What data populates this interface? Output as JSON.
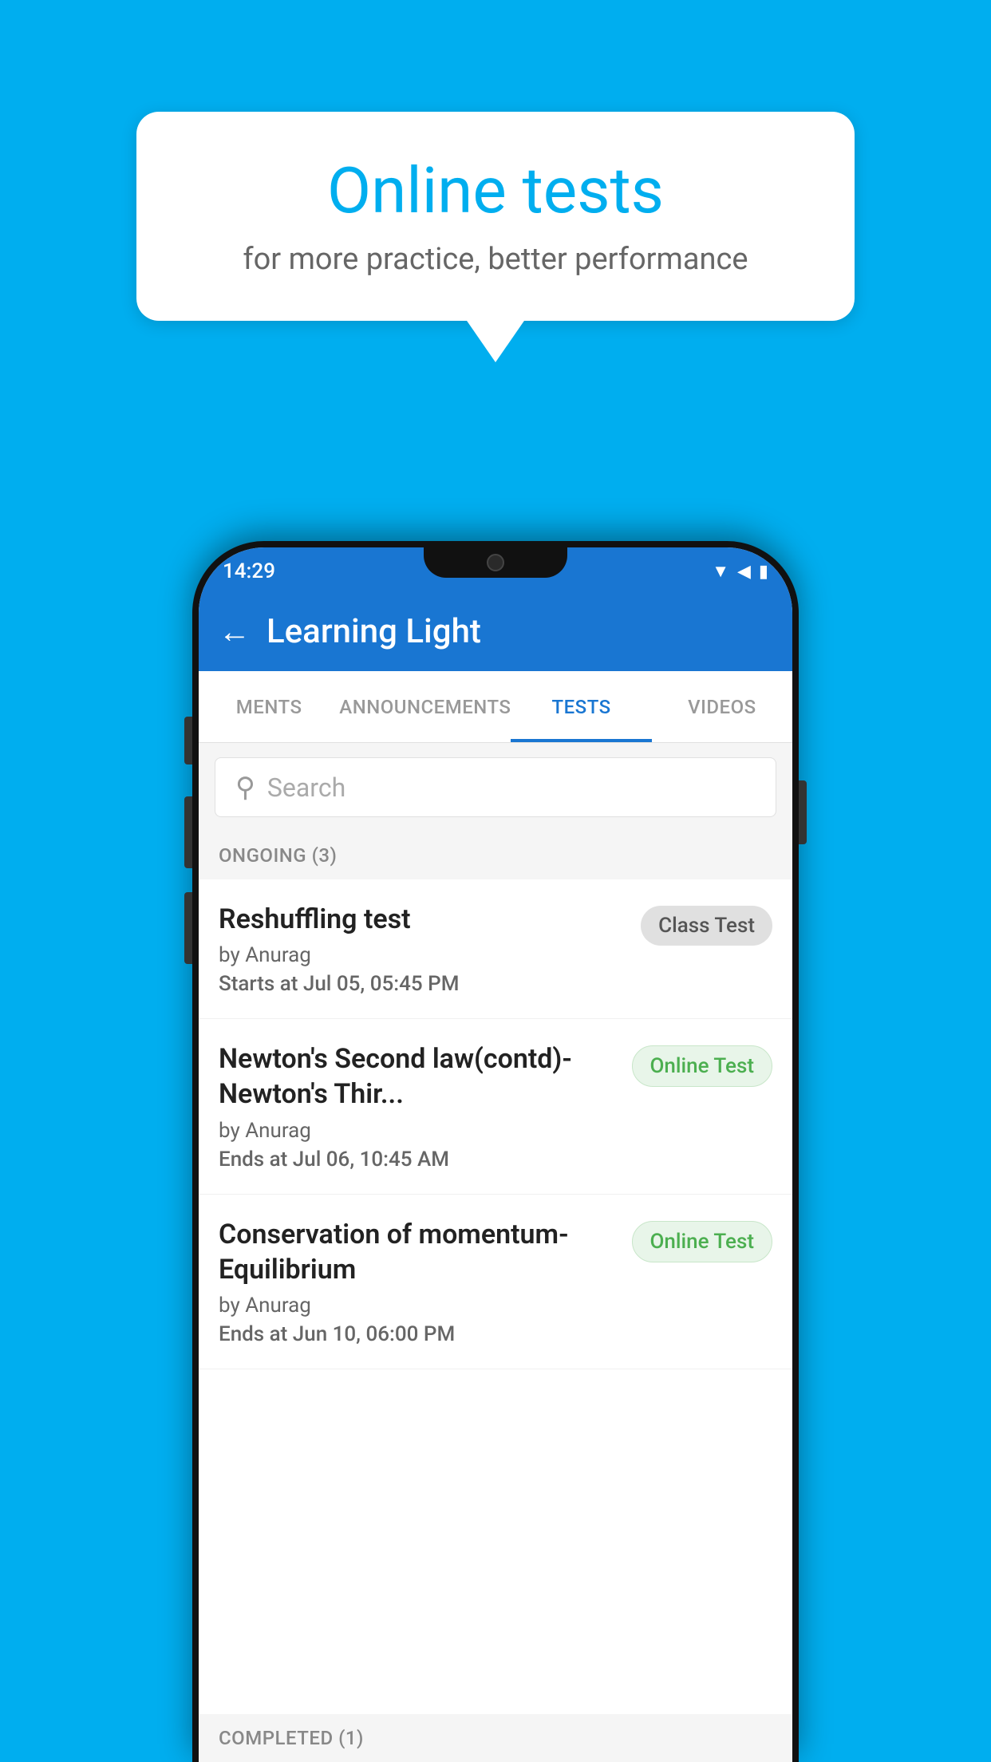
{
  "background": {
    "color": "#00AEEF"
  },
  "speech_bubble": {
    "title": "Online tests",
    "subtitle": "for more practice, better performance"
  },
  "phone": {
    "status_bar": {
      "time": "14:29",
      "icons": [
        "wifi",
        "signal",
        "battery"
      ]
    },
    "app_bar": {
      "title": "Learning Light",
      "back_label": "←"
    },
    "tabs": [
      {
        "label": "MENTS",
        "active": false
      },
      {
        "label": "ANNOUNCEMENTS",
        "active": false
      },
      {
        "label": "TESTS",
        "active": true
      },
      {
        "label": "VIDEOS",
        "active": false
      }
    ],
    "search": {
      "placeholder": "Search"
    },
    "sections": [
      {
        "header": "ONGOING (3)",
        "items": [
          {
            "name": "Reshuffling test",
            "author": "by Anurag",
            "time_label": "Starts at",
            "time_value": "Jul 05, 05:45 PM",
            "badge": "Class Test",
            "badge_type": "class"
          },
          {
            "name": "Newton's Second law(contd)-Newton's Thir...",
            "author": "by Anurag",
            "time_label": "Ends at",
            "time_value": "Jul 06, 10:45 AM",
            "badge": "Online Test",
            "badge_type": "online"
          },
          {
            "name": "Conservation of momentum-Equilibrium",
            "author": "by Anurag",
            "time_label": "Ends at",
            "time_value": "Jun 10, 06:00 PM",
            "badge": "Online Test",
            "badge_type": "online"
          }
        ]
      }
    ],
    "completed_header": "COMPLETED (1)"
  }
}
